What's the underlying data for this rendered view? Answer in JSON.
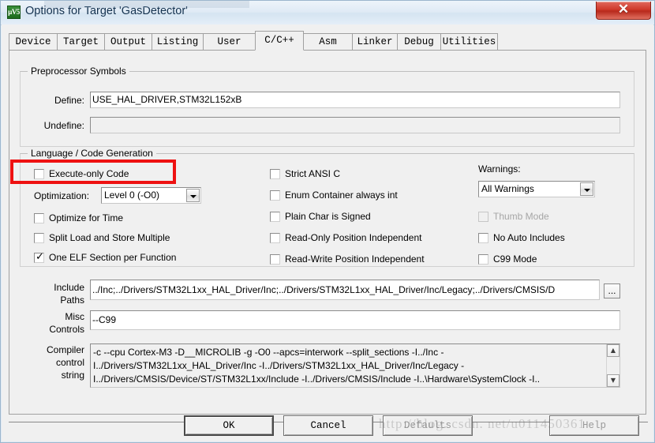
{
  "window": {
    "title": "Options for Target 'GasDetector'",
    "icon": "keil-uvision-icon",
    "icon_text": "µV5",
    "close_label": "✕"
  },
  "tabs": [
    {
      "label": "Device",
      "active": false
    },
    {
      "label": "Target",
      "active": false
    },
    {
      "label": "Output",
      "active": false
    },
    {
      "label": "Listing",
      "active": false
    },
    {
      "label": "User",
      "active": false
    },
    {
      "label": "C/C++",
      "active": true
    },
    {
      "label": "Asm",
      "active": false
    },
    {
      "label": "Linker",
      "active": false
    },
    {
      "label": "Debug",
      "active": false
    },
    {
      "label": "Utilities",
      "active": false
    }
  ],
  "preprocessor": {
    "group_title": "Preprocessor Symbols",
    "define_label": "Define:",
    "define_value": "USE_HAL_DRIVER,STM32L152xB",
    "undefine_label": "Undefine:",
    "undefine_value": ""
  },
  "language": {
    "group_title": "Language / Code Generation",
    "col1": [
      {
        "label": "Execute-only Code",
        "checked": false,
        "disabled": false
      },
      {
        "label": "Optimize for Time",
        "checked": false,
        "disabled": false
      },
      {
        "label": "Split Load and Store Multiple",
        "checked": false,
        "disabled": false
      },
      {
        "label": "One ELF Section per Function",
        "checked": true,
        "disabled": false
      }
    ],
    "optimization_label": "Optimization:",
    "optimization_value": "Level 0 (-O0)",
    "col2": [
      {
        "label": "Strict ANSI C",
        "checked": false,
        "disabled": false
      },
      {
        "label": "Enum Container always int",
        "checked": false,
        "disabled": false
      },
      {
        "label": "Plain Char is Signed",
        "checked": false,
        "disabled": false
      },
      {
        "label": "Read-Only Position Independent",
        "checked": false,
        "disabled": false
      },
      {
        "label": "Read-Write Position Independent",
        "checked": false,
        "disabled": false
      }
    ],
    "warnings_label": "Warnings:",
    "warnings_value": "All Warnings",
    "col3": [
      {
        "label": "Thumb Mode",
        "checked": false,
        "disabled": true
      },
      {
        "label": "No Auto Includes",
        "checked": false,
        "disabled": false
      },
      {
        "label": "C99 Mode",
        "checked": false,
        "disabled": false
      }
    ]
  },
  "paths": {
    "include_label_line1": "Include",
    "include_label_line2": "Paths",
    "include_value": "../Inc;../Drivers/STM32L1xx_HAL_Driver/Inc;../Drivers/STM32L1xx_HAL_Driver/Inc/Legacy;../Drivers/CMSIS/D",
    "browse_label": "...",
    "misc_label_line1": "Misc",
    "misc_label_line2": "Controls",
    "misc_value": "--C99",
    "compiler_label_line1": "Compiler",
    "compiler_label_line2": "control",
    "compiler_label_line3": "string",
    "compiler_lines": [
      "-c --cpu Cortex-M3 -D__MICROLIB -g -O0 --apcs=interwork --split_sections -I../Inc -",
      "I../Drivers/STM32L1xx_HAL_Driver/Inc -I../Drivers/STM32L1xx_HAL_Driver/Inc/Legacy -",
      "I../Drivers/CMSIS/Device/ST/STM32L1xx/Include -I../Drivers/CMSIS/Include -I..\\Hardware\\SystemClock -I.."
    ],
    "scroll_up": "▲",
    "scroll_down": "▼"
  },
  "footer": {
    "ok": "OK",
    "cancel": "Cancel",
    "defaults": "Defaults",
    "help": "Help"
  },
  "watermark": {
    "text": "http://blog. csdn. net/u011450361"
  },
  "colors": {
    "highlight": "#ee1111",
    "dialog_bg": "#f0f0f0",
    "titlebar": "#dfeaf5",
    "close_btn": "#cf3a2b",
    "disabled_text": "#a6a6a6"
  }
}
